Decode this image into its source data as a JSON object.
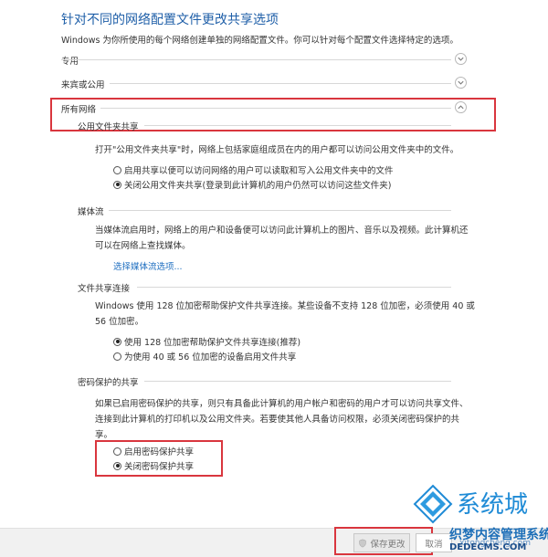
{
  "header": {
    "title": "针对不同的网络配置文件更改共享选项",
    "description": "Windows 为你所使用的每个网络创建单独的网络配置文件。你可以针对每个配置文件选择特定的选项。"
  },
  "profiles": {
    "private": "专用",
    "guest_public": "来宾或公用",
    "all_networks": "所有网络"
  },
  "public_folder_sharing": {
    "heading": "公用文件夹共享",
    "description": "打开\"公用文件夹共享\"时，网络上包括家庭组成员在内的用户都可以访问公用文件夹中的文件。",
    "option_on": "启用共享以便可以访问网络的用户可以读取和写入公用文件夹中的文件",
    "option_off": "关闭公用文件夹共享(登录到此计算机的用户仍然可以访问这些文件夹)"
  },
  "media_streaming": {
    "heading": "媒体流",
    "description_line1": "当媒体流启用时，网络上的用户和设备便可以访问此计算机上的图片、音乐以及视频。此计算机还",
    "description_line2": "可以在网络上查找媒体。",
    "link": "选择媒体流选项..."
  },
  "file_sharing_connections": {
    "heading": "文件共享连接",
    "description_line1": "Windows 使用 128 位加密帮助保护文件共享连接。某些设备不支持 128 位加密，必须使用 40 或",
    "description_line2": "56 位加密。",
    "option_128": "使用 128 位加密帮助保护文件共享连接(推荐)",
    "option_40_56": "为使用 40 或 56 位加密的设备启用文件共享"
  },
  "password_protected_sharing": {
    "heading": "密码保护的共享",
    "description_line1": "如果已启用密码保护的共享，则只有具备此计算机的用户帐户和密码的用户才可以访问共享文件、",
    "description_line2": "连接到此计算机的打印机以及公用文件夹。若要使其他人具备访问权限，必须关闭密码保护的共",
    "description_line3": "享。",
    "option_on": "启用密码保护共享",
    "option_off": "关闭密码保护共享"
  },
  "footer": {
    "save_label": "保存更改",
    "cancel_label": "取消"
  },
  "watermark": {
    "site1": "系统城",
    "site1_url": "xitongcheng.com",
    "site2": "织梦内容管理系统",
    "site2_url": "DEDECMS.COM"
  },
  "colors": {
    "title": "#1f5fa8",
    "link": "#1f6fc0",
    "highlight_box": "#d9363e"
  }
}
